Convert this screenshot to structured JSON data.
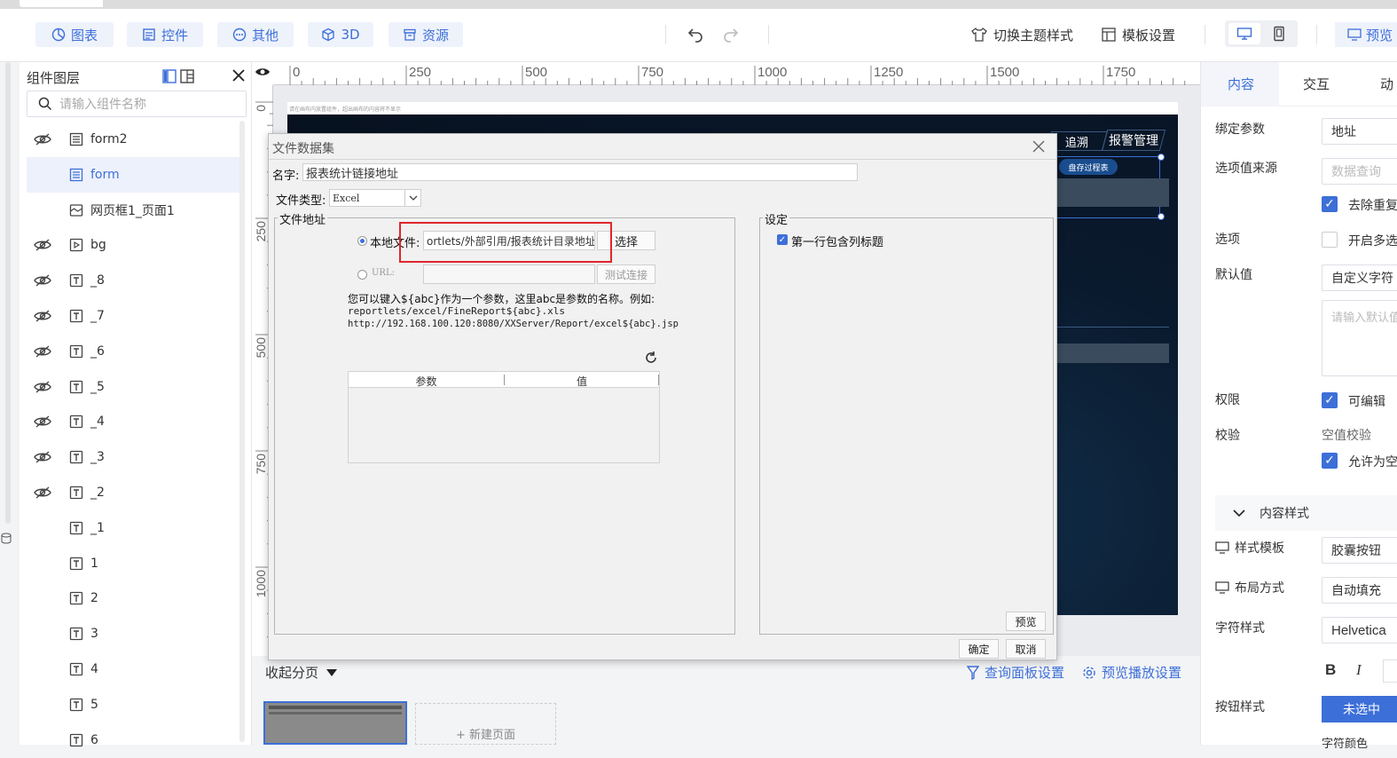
{
  "toolbar": {
    "chart_btn": "图表",
    "widget_btn": "控件",
    "other_btn": "其他",
    "threed_btn": "3D",
    "resource_btn": "资源",
    "theme_label": "切换主题样式",
    "template_label": "模板设置",
    "preview_label": "预览"
  },
  "layers": {
    "title": "组件图层",
    "search_placeholder": "请输入组件名称",
    "items": [
      {
        "label": "form2",
        "hidden": true,
        "icon": "form-icon"
      },
      {
        "label": "form",
        "hidden": false,
        "icon": "form-icon",
        "selected": true
      },
      {
        "label": "网页框1_页面1",
        "hidden": false,
        "icon": "webframe-icon"
      },
      {
        "label": "bg",
        "hidden": true,
        "icon": "media-icon"
      },
      {
        "label": "_8",
        "hidden": true,
        "icon": "text-icon"
      },
      {
        "label": "_7",
        "hidden": true,
        "icon": "text-icon"
      },
      {
        "label": "_6",
        "hidden": true,
        "icon": "text-icon"
      },
      {
        "label": "_5",
        "hidden": true,
        "icon": "text-icon"
      },
      {
        "label": "_4",
        "hidden": true,
        "icon": "text-icon"
      },
      {
        "label": "_3",
        "hidden": true,
        "icon": "text-icon"
      },
      {
        "label": "_2",
        "hidden": true,
        "icon": "text-icon"
      },
      {
        "label": "_1",
        "hidden": false,
        "icon": "text-icon"
      },
      {
        "label": "1",
        "hidden": false,
        "icon": "text-icon"
      },
      {
        "label": "2",
        "hidden": false,
        "icon": "text-icon"
      },
      {
        "label": "3",
        "hidden": false,
        "icon": "text-icon"
      },
      {
        "label": "4",
        "hidden": false,
        "icon": "text-icon"
      },
      {
        "label": "5",
        "hidden": false,
        "icon": "text-icon"
      },
      {
        "label": "6",
        "hidden": false,
        "icon": "text-icon"
      }
    ]
  },
  "ruler": {
    "h_ticks": [
      "0",
      "250",
      "500",
      "750",
      "1000",
      "1250",
      "1500",
      "1750"
    ],
    "v_ticks": [
      "0",
      "250",
      "500",
      "750",
      "1000"
    ]
  },
  "canvas": {
    "hint": "请在画布内放置组件，超出画布的内容将不显示",
    "nav_trace": "追溯",
    "nav_alarm": "报警管理",
    "chip": "盘存过程表"
  },
  "bottom": {
    "collapse": "收起分页",
    "query_settings": "查询面板设置",
    "play_settings": "预览播放设置",
    "new_page": "+ 新建页面"
  },
  "right": {
    "tabs": [
      "内容",
      "交互",
      "动"
    ],
    "bind_param_label": "绑定参数",
    "bind_param_value": "地址",
    "option_source_label": "选项值来源",
    "option_source_placeholder": "数据查询",
    "dedupe_label": "去除重复",
    "options_label": "选项",
    "multi_label": "开启多选",
    "default_label": "默认值",
    "default_value": "自定义字符",
    "default_placeholder": "请输入默认值",
    "permission_label": "权限",
    "editable_label": "可编辑",
    "validate_label": "校验",
    "empty_check": "空值校验",
    "allow_empty": "允许为空",
    "content_style": "内容样式",
    "style_template_label": "样式模板",
    "style_template_value": "胶囊按钮",
    "layout_label": "布局方式",
    "layout_value": "自动填充",
    "font_label": "字符样式",
    "font_value": "Helvetica",
    "bold": "B",
    "italic": "I",
    "button_style_label": "按钮样式",
    "unselected_btn": "未选中",
    "font_color_label": "字符颜色"
  },
  "dialog": {
    "title": "文件数据集",
    "name_label": "名字:",
    "name_value": "报表统计链接地址",
    "type_label": "文件类型:",
    "type_value": "Excel",
    "addr_legend": "文件地址",
    "local_label": "本地文件:",
    "local_value": "ortlets/外部引用/报表统计目录地址E",
    "choose_btn": "选择",
    "url_label": "URL:",
    "test_btn": "测试连接",
    "hint_line1": "您可以键入${abc}作为一个参数，这里abc是参数的名称。例如:",
    "hint_line2": "reportlets/excel/FineReport${abc}.xls",
    "hint_line3": "http://192.168.100.120:8080/XXServer/Report/excel${abc}.jsp",
    "col_param": "参数",
    "col_value": "值",
    "settings_legend": "设定",
    "first_row_header": "第一行包含列标题",
    "preview_btn": "预览",
    "ok_btn": "确定",
    "cancel_btn": "取消"
  }
}
